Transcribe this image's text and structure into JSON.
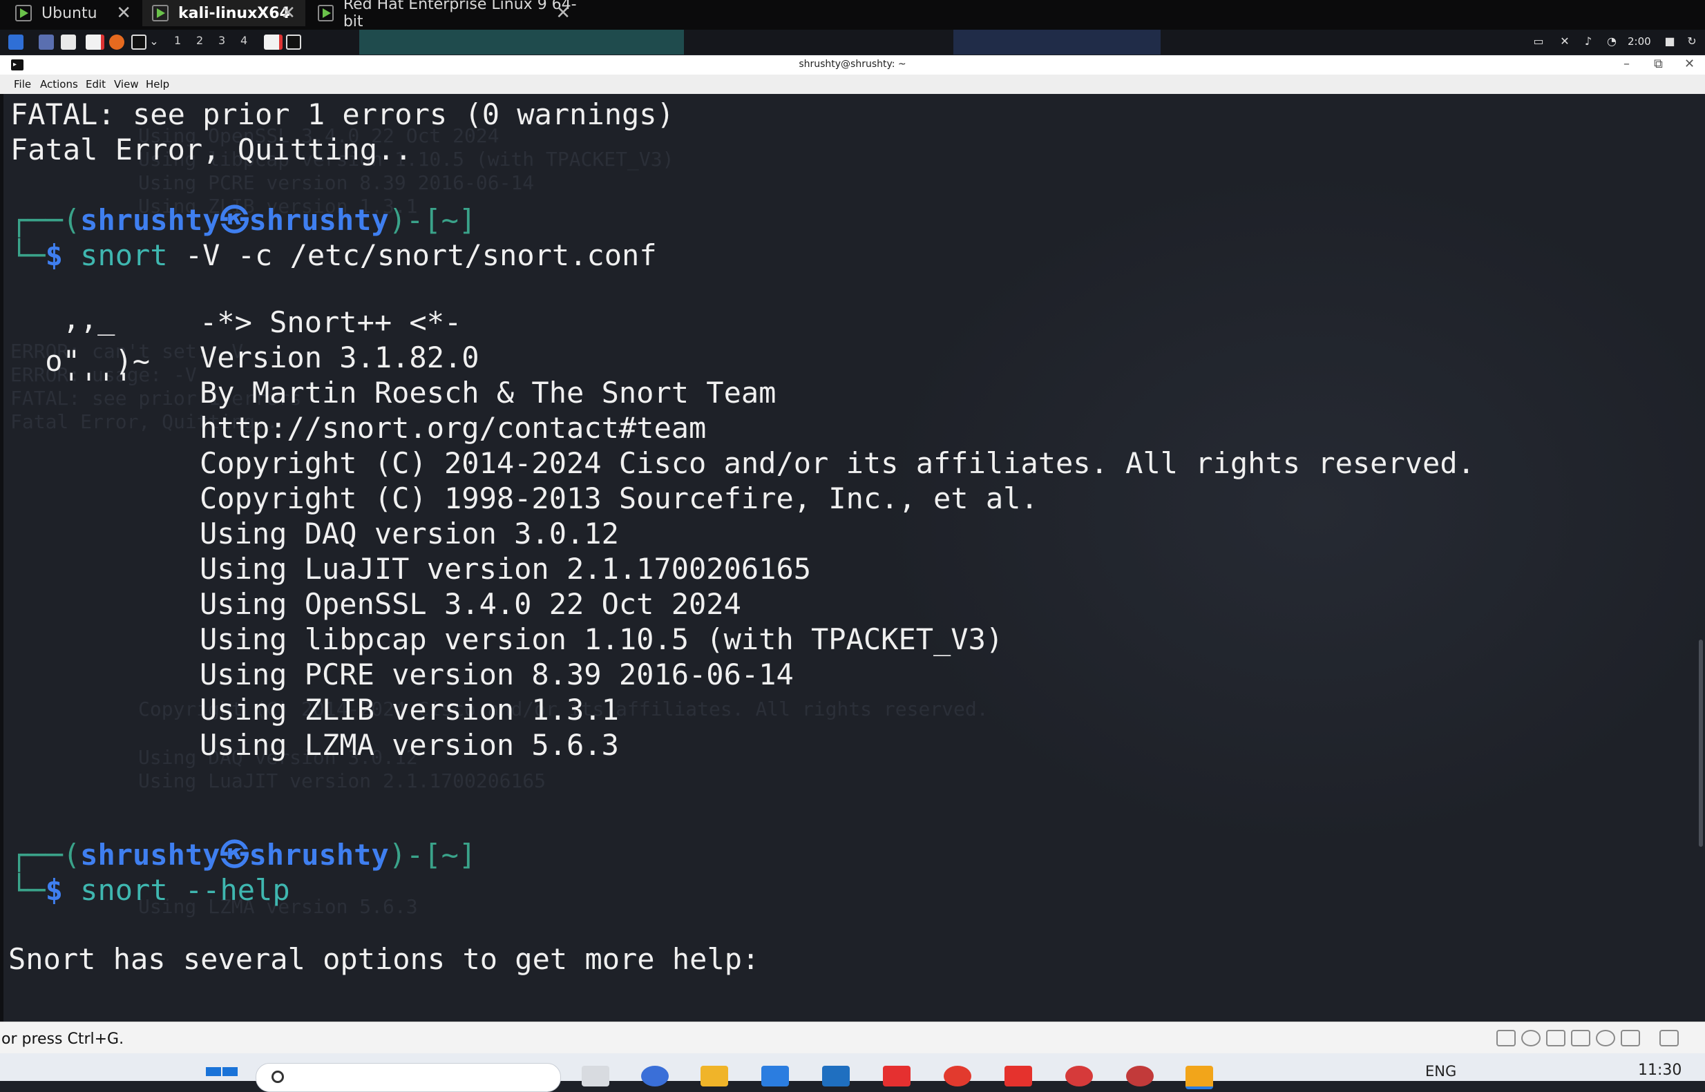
{
  "vm_tabs": [
    {
      "label": "Ubuntu",
      "active": false
    },
    {
      "label": "kali-linuxX64",
      "active": true
    },
    {
      "label": "Red Hat Enterprise Linux 9 64-bit",
      "active": false
    }
  ],
  "kali_panel": {
    "workspaces": [
      "1",
      "2",
      "3",
      "4"
    ],
    "clock": "2:00"
  },
  "terminal": {
    "title": "shrushty@shrushty: ~",
    "menu": [
      "File",
      "Actions",
      "Edit",
      "View",
      "Help"
    ],
    "lines": {
      "fatal1": "FATAL: see prior 1 errors (0 warnings)",
      "fatal2": "Fatal Error, Quitting..",
      "prompt1": {
        "open": "┌──(",
        "user": "shrushty㉿shrushty",
        "close": ")-[~]",
        "corner": "└─",
        "dollar": "$",
        "cmd": "snort",
        "args": " -V -c /etc/snort/snort.conf"
      },
      "pig1": "  ,,_",
      "pig2": " o\"  )~",
      "pig3": "  ''''",
      "snort_banner": "-*> Snort++ <*-",
      "version": "Version 3.1.82.0",
      "by": "By Martin Roesch & The Snort Team",
      "url": "http://snort.org/contact#team",
      "copy1": "Copyright (C) 2014-2024 Cisco and/or its affiliates. All rights reserved.",
      "copy2": "Copyright (C) 1998-2013 Sourcefire, Inc., et al.",
      "daq": "Using DAQ version 3.0.12",
      "luajit": "Using LuaJIT version 2.1.1700206165",
      "openssl": "Using OpenSSL 3.4.0 22 Oct 2024",
      "libpcap": "Using libpcap version 1.10.5 (with TPACKET_V3)",
      "pcre": "Using PCRE version 8.39 2016-06-14",
      "zlib": "Using ZLIB version 1.3.1",
      "lzma": "Using LZMA version 5.6.3",
      "prompt2": {
        "open": "┌──(",
        "user": "shrushty㉿shrushty",
        "close": ")-[~]",
        "corner": "└─",
        "dollar": "$",
        "cmd": "snort --help"
      },
      "help": "Snort has several options to get more help:"
    },
    "ghost_lines": [
      "Using OpenSSL 3.4.0 22 Oct 2024",
      "Using libpcap version 1.10.5 (with TPACKET_V3)",
      "Using PCRE version 8.39 2016-06-14",
      "Using ZLIB version 1.3.1",
      "ERROR: can't set: -V",
      "ERROR: usage: -V",
      "FATAL: see prior 1 errors",
      "Fatal Error, Quitting..",
      "Copyright (C) 2014-2024 Cisco and/or its affiliates. All rights reserved.",
      "Using DAQ version 3.0.12",
      "Using LuaJIT version 2.1.1700206165",
      "Using LZMA version 5.6.3"
    ]
  },
  "host_status": {
    "hint": "or press Ctrl+G."
  },
  "taskbar": {
    "search_placeholder": "Search",
    "language": "ENG",
    "time": "11:30"
  }
}
